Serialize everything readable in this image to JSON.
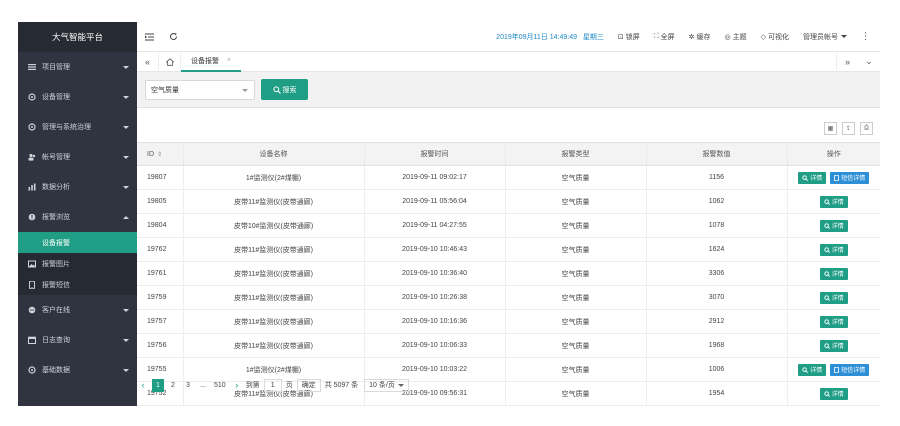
{
  "sidebar": {
    "brand": "大气智能平台",
    "items": [
      {
        "icon": "list-icon",
        "label": "项目管理"
      },
      {
        "icon": "gear-icon",
        "label": "设备管理"
      },
      {
        "icon": "gear-icon",
        "label": "管理与系统治理"
      },
      {
        "icon": "users-icon",
        "label": "帐号管理"
      },
      {
        "icon": "chart-icon",
        "label": "数据分析"
      },
      {
        "icon": "alarm-icon",
        "label": "报警浏览",
        "expanded": true
      }
    ],
    "subitems": [
      {
        "label": "设备报警",
        "active": true
      },
      {
        "icon": "image-icon",
        "label": "报警图片"
      },
      {
        "icon": "phone-icon",
        "label": "报警短信"
      }
    ],
    "items2": [
      {
        "icon": "chat-icon",
        "label": "客户在线"
      },
      {
        "icon": "calendar-icon",
        "label": "日志查询"
      },
      {
        "icon": "gear-icon",
        "label": "基础数据"
      }
    ]
  },
  "topbar": {
    "datetime": "2019年09月11日 14:49:49",
    "weekday": "星期三",
    "tools": [
      {
        "icon": "lock-icon",
        "label": "锁屏"
      },
      {
        "icon": "fullscreen-icon",
        "label": "全屏"
      },
      {
        "icon": "cache-icon",
        "label": "缓存"
      },
      {
        "icon": "theme-icon",
        "label": "主题"
      },
      {
        "icon": "tag-icon",
        "label": "可视化"
      }
    ],
    "admin": "管理员帐号"
  },
  "tabs": {
    "active": "设备报警"
  },
  "search": {
    "select_value": "空气质量",
    "button": "搜索"
  },
  "table": {
    "headers": [
      "ID",
      "设备名称",
      "报警时间",
      "报警类型",
      "报警数值",
      "操作"
    ],
    "detail_label": "详情",
    "sms_label": "短信详情",
    "rows": [
      {
        "id": "19807",
        "name": "1#监测仪(2#煤棚)",
        "time": "2019-09-11 09:02:17",
        "type": "空气质量",
        "value": "1156",
        "sms": true
      },
      {
        "id": "19805",
        "name": "皮带11#监测仪(皮带通廊)",
        "time": "2019-09-11 05:56:04",
        "type": "空气质量",
        "value": "1062",
        "sms": false
      },
      {
        "id": "19804",
        "name": "皮带10#监测仪(皮带通廊)",
        "time": "2019-09-11 04:27:55",
        "type": "空气质量",
        "value": "1078",
        "sms": false
      },
      {
        "id": "19762",
        "name": "皮带11#监测仪(皮带通廊)",
        "time": "2019-09-10 10:46:43",
        "type": "空气质量",
        "value": "1624",
        "sms": false
      },
      {
        "id": "19761",
        "name": "皮带11#监测仪(皮带通廊)",
        "time": "2019-09-10 10:36:40",
        "type": "空气质量",
        "value": "3306",
        "sms": false
      },
      {
        "id": "19759",
        "name": "皮带11#监测仪(皮带通廊)",
        "time": "2019-09-10 10:26:38",
        "type": "空气质量",
        "value": "3070",
        "sms": false
      },
      {
        "id": "19757",
        "name": "皮带11#监测仪(皮带通廊)",
        "time": "2019-09-10 10:16:36",
        "type": "空气质量",
        "value": "2912",
        "sms": false
      },
      {
        "id": "19756",
        "name": "皮带11#监测仪(皮带通廊)",
        "time": "2019-09-10 10:06:33",
        "type": "空气质量",
        "value": "1968",
        "sms": false
      },
      {
        "id": "19755",
        "name": "1#监测仪(2#煤棚)",
        "time": "2019-09-10 10:03:22",
        "type": "空气质量",
        "value": "1006",
        "sms": true
      },
      {
        "id": "19752",
        "name": "皮带11#监测仪(皮带通廊)",
        "time": "2019-09-10 09:56:31",
        "type": "空气质量",
        "value": "1954",
        "sms": false
      }
    ]
  },
  "pager": {
    "pages": [
      "1",
      "2",
      "3",
      "...",
      "510"
    ],
    "goto_label": "到第",
    "goto_value": "1",
    "page_unit": "页",
    "confirm": "确定",
    "total": "共 5097 条",
    "size": "10 条/页"
  },
  "colors": {
    "accent": "#1f9e85",
    "sidebar_bg": "#2f3440",
    "link_blue": "#1e88c7",
    "sms_blue": "#2d8fd6"
  }
}
